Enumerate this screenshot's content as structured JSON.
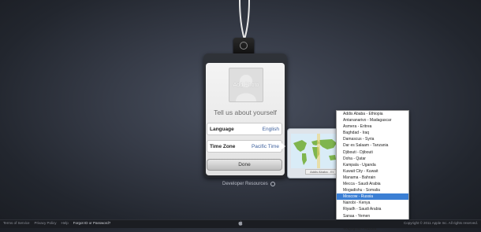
{
  "badge": {
    "photo_label": "Add Photo",
    "heading": "Tell us about yourself",
    "language_label": "Language",
    "language_value": "English",
    "timezone_label": "Time Zone",
    "timezone_value": "Pacific Time",
    "done_label": "Done"
  },
  "map_caption": "Addis Ababa - Et",
  "timezone_options": [
    "Addis Ababa - Ethiopia",
    "Antananarivo - Madagascar",
    "Asmera - Eritrea",
    "Baghdad - Iraq",
    "Damascus - Syria",
    "Dar es Salaam - Tanzania",
    "Djibouti - Djibouti",
    "Doha - Qatar",
    "Kampala - Uganda",
    "Kuwait City - Kuwait",
    "Manama - Bahrain",
    "Mecca - Saudi Arabia",
    "Mogadishu - Somalia",
    "Moscow - Russia",
    "Nairobi - Kenya",
    "Riyadh - Saudi Arabia",
    "Sanaa - Yemen",
    "St. Petersburg - Russia",
    "Volgograd - Russia"
  ],
  "selected_option": "Moscow - Russia",
  "developer_resources": "Developer Resources",
  "footer": {
    "links": [
      "Terms of Service",
      "Privacy Policy",
      "Help",
      "Forgot ID or Password?"
    ],
    "copyright": "Copyright © 2011 Apple Inc. All rights reserved."
  },
  "colors": {
    "accent": "#3b7fd4",
    "value_text": "#3c5f9c"
  }
}
